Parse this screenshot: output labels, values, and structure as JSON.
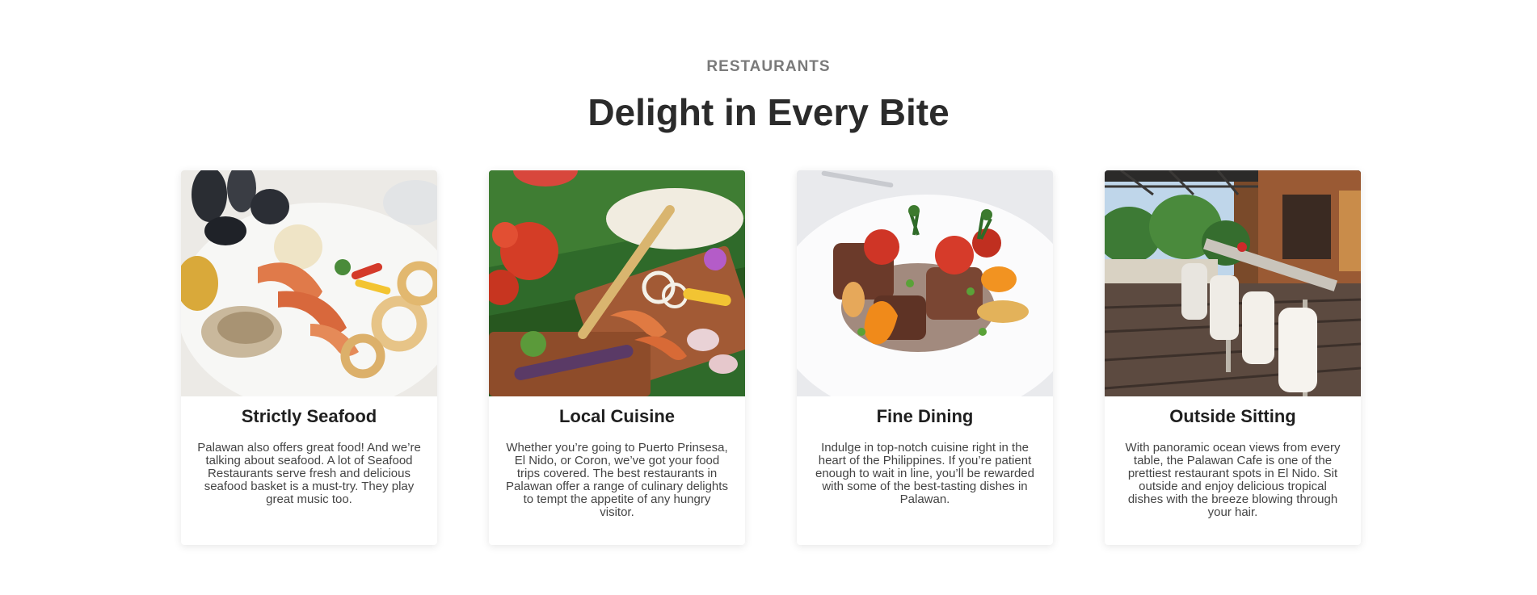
{
  "section": {
    "eyebrow": "RESTAURANTS",
    "title": "Delight in Every Bite"
  },
  "cards": [
    {
      "title": "Strictly Seafood",
      "text": "Palawan also offers great food! And we’re talking about seafood. A lot of Seafood Restaurants serve fresh and delicious seafood basket is a must-try. They play great music too.",
      "image_icon": "seafood-platter-photo"
    },
    {
      "title": "Local Cuisine",
      "text": "Whether you’re going to Puerto Prinsesa, El Nido, or Coron, we’ve got your food trips covered. The best restaurants in Palawan offer a range of culinary delights to tempt the appetite of any hungry visitor.",
      "image_icon": "boodle-feast-photo"
    },
    {
      "title": "Fine Dining",
      "text": "Indulge in top-notch cuisine right in the heart of the Philippines. If you’re patient enough to wait in line, you’ll be rewarded with some of the best-tasting dishes in Palawan.",
      "image_icon": "fine-dining-plate-photo"
    },
    {
      "title": "Outside Sitting",
      "text": "With panoramic ocean views from every table, the Palawan Cafe is one of the prettiest restaurant spots in El Nido. Sit outside and enjoy delicious tropical dishes with the breeze blowing through your hair.",
      "image_icon": "outdoor-terrace-photo"
    }
  ]
}
